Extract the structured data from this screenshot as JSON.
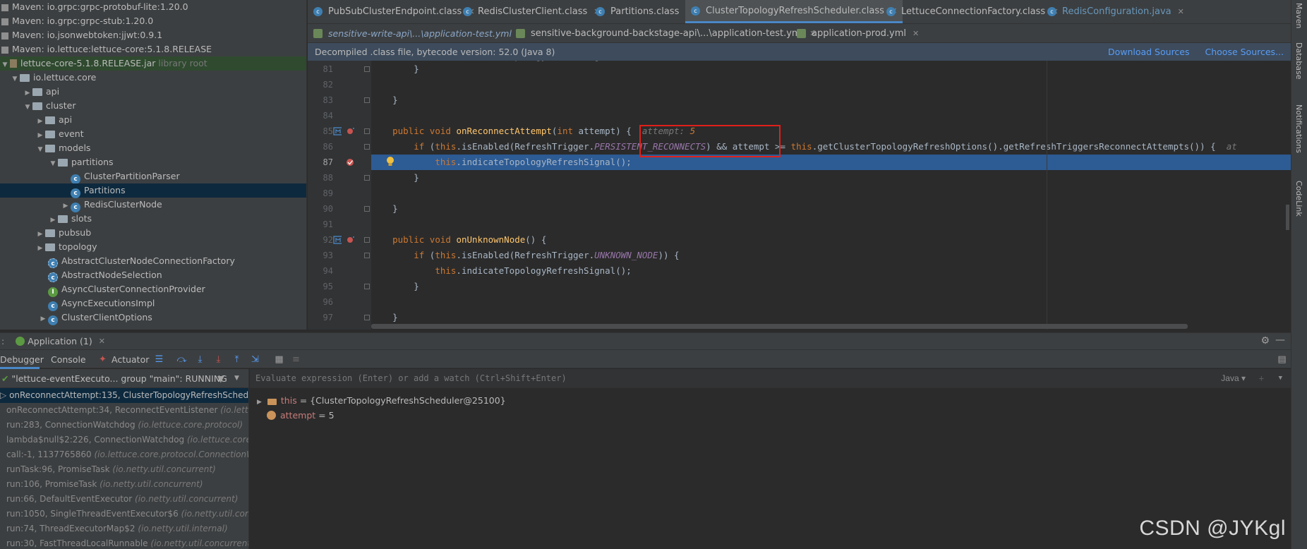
{
  "project_tree": {
    "rows": [
      {
        "label": "Maven: io.grpc:grpc-protobuf-lite:1.20.0",
        "icon": "library-icon"
      },
      {
        "label": "Maven: io.grpc:grpc-stub:1.20.0",
        "icon": "library-icon"
      },
      {
        "label": "Maven: io.jsonwebtoken:jjwt:0.9.1",
        "icon": "library-icon"
      },
      {
        "label": "Maven: io.lettuce:lettuce-core:5.1.8.RELEASE",
        "icon": "library-icon"
      },
      {
        "label": "lettuce-core-5.1.8.RELEASE.jar",
        "suffix": "library root",
        "icon": "jar-icon"
      },
      {
        "label": "io.lettuce.core",
        "icon": "package-icon"
      },
      {
        "label": "api",
        "icon": "package-icon"
      },
      {
        "label": "cluster",
        "icon": "package-icon"
      },
      {
        "label": "api",
        "icon": "package-icon"
      },
      {
        "label": "event",
        "icon": "package-icon"
      },
      {
        "label": "models",
        "icon": "package-icon"
      },
      {
        "label": "partitions",
        "icon": "package-icon"
      },
      {
        "label": "ClusterPartitionParser",
        "icon": "class-icon"
      },
      {
        "label": "Partitions",
        "icon": "class-icon"
      },
      {
        "label": "RedisClusterNode",
        "icon": "class-icon"
      },
      {
        "label": "slots",
        "icon": "package-icon"
      },
      {
        "label": "pubsub",
        "icon": "package-icon"
      },
      {
        "label": "topology",
        "icon": "package-icon"
      },
      {
        "label": "AbstractClusterNodeConnectionFactory",
        "icon": "abstract-class-icon"
      },
      {
        "label": "AbstractNodeSelection",
        "icon": "abstract-class-icon"
      },
      {
        "label": "AsyncClusterConnectionProvider",
        "icon": "interface-icon"
      },
      {
        "label": "AsyncExecutionsImpl",
        "icon": "class-icon"
      },
      {
        "label": "ClusterClientOptions",
        "icon": "class-icon"
      }
    ]
  },
  "editor_tabs": [
    {
      "label": "PubSubClusterEndpoint.class"
    },
    {
      "label": "RedisClusterClient.class"
    },
    {
      "label": "Partitions.class"
    },
    {
      "label": "ClusterTopologyRefreshScheduler.class"
    },
    {
      "label": "LettuceConnectionFactory.class"
    },
    {
      "label": "RedisConfiguration.java"
    }
  ],
  "editor_tabs_row2": [
    {
      "label": "sensitive-write-api\\...\\application-test.yml"
    },
    {
      "label": "sensitive-background-backstage-api\\...\\application-test.yml"
    },
    {
      "label": "application-prod.yml"
    }
  ],
  "banner": {
    "text": "Decompiled .class file, bytecode version: 52.0 (Java 8)",
    "download": "Download Sources",
    "choose": "Choose Sources..."
  },
  "code": {
    "line_numbers": [
      "",
      "81",
      "82",
      "83",
      "84",
      "85",
      "86",
      "87",
      "88",
      "89",
      "90",
      "91",
      "92",
      "93",
      "94",
      "95",
      "96",
      "97"
    ],
    "l80_a": "this",
    "l80_b": ".",
    "l80_c": "indicateTopologyRefreshSignal",
    "l80_d": "();",
    "l81": "}",
    "l83": "}",
    "l85_public": "public",
    "l85_void": "void",
    "l85_name": "onReconnectAttempt",
    "l85_sig": "(",
    "l85_int": "int",
    "l85_rest": " attempt) {",
    "l85_hint_name": "attempt:",
    "l85_hint_val": "5",
    "l86_if": "if",
    "l86_this1": "this",
    "l86_a": ".isEnabled(RefreshTrigger.",
    "l86_const": "PERSISTENT_RECONNECTS",
    "l86_b": ") && attempt >= ",
    "l86_this2": "this",
    "l86_c": ".getClusterTopologyRefreshOptions().getRefreshTriggersReconnectAttempts()) {",
    "l86_hint": "at",
    "l87_this": "this",
    "l87_rest": ".indicateTopologyRefreshSignal();",
    "l88": "}",
    "l90": "}",
    "l92_public": "public",
    "l92_void": "void",
    "l92_name": "onUnknownNode",
    "l92_rest": "() {",
    "l93_if": "if",
    "l93_this": "this",
    "l93_a": ".isEnabled(RefreshTrigger.",
    "l93_const": "UNKNOWN_NODE",
    "l93_b": ")) {",
    "l94_this": "this",
    "l94_rest": ".indicateTopologyRefreshSignal();",
    "l95": "}",
    "l97": "}"
  },
  "right_strip": {
    "maven": "Maven",
    "database": "Database",
    "notifications": "Notifications",
    "codelink": "CodeLink"
  },
  "debug": {
    "run_config": "Application (1)",
    "tabs": {
      "debugger": "Debugger",
      "console": "Console",
      "actuator": "Actuator"
    },
    "thread": "\"lettuce-eventExecuto... group \"main\": RUNNING",
    "frames": [
      {
        "method": "onReconnectAttempt:135, ClusterTopologyRefreshScheduler",
        "pkg": ""
      },
      {
        "method": "onReconnectAttempt:34, ReconnectEventListener",
        "pkg": "(io.lettuce.c"
      },
      {
        "method": "run:283, ConnectionWatchdog",
        "pkg": "(io.lettuce.core.protocol)"
      },
      {
        "method": "lambda$null$2:226, ConnectionWatchdog",
        "pkg": "(io.lettuce.core.p"
      },
      {
        "method": "call:-1, 1137765860",
        "pkg": "(io.lettuce.core.protocol.ConnectionWa"
      },
      {
        "method": "runTask:96, PromiseTask",
        "pkg": "(io.netty.util.concurrent)"
      },
      {
        "method": "run:106, PromiseTask",
        "pkg": "(io.netty.util.concurrent)"
      },
      {
        "method": "run:66, DefaultEventExecutor",
        "pkg": "(io.netty.util.concurrent)"
      },
      {
        "method": "run:1050, SingleThreadEventExecutor$6",
        "pkg": "(io.netty.util.concur"
      },
      {
        "method": "run:74, ThreadExecutorMap$2",
        "pkg": "(io.netty.util.internal)"
      },
      {
        "method": "run:30, FastThreadLocalRunnable",
        "pkg": "(io.netty.util.concurrent)"
      }
    ],
    "eval_placeholder": "Evaluate expression (Enter) or add a watch (Ctrl+Shift+Enter)",
    "eval_lang": "Java",
    "variables": [
      {
        "name": "this",
        "value": " = {ClusterTopologyRefreshScheduler@25100}"
      },
      {
        "name": "attempt",
        "value": " = 5"
      }
    ]
  },
  "watermark": "CSDN @JYKgl",
  "colors": {
    "accent": "#4a88c7",
    "highlight_line": "#2d5b94",
    "breakpoint": "#c75450",
    "annotation_box": "#e0201b"
  }
}
